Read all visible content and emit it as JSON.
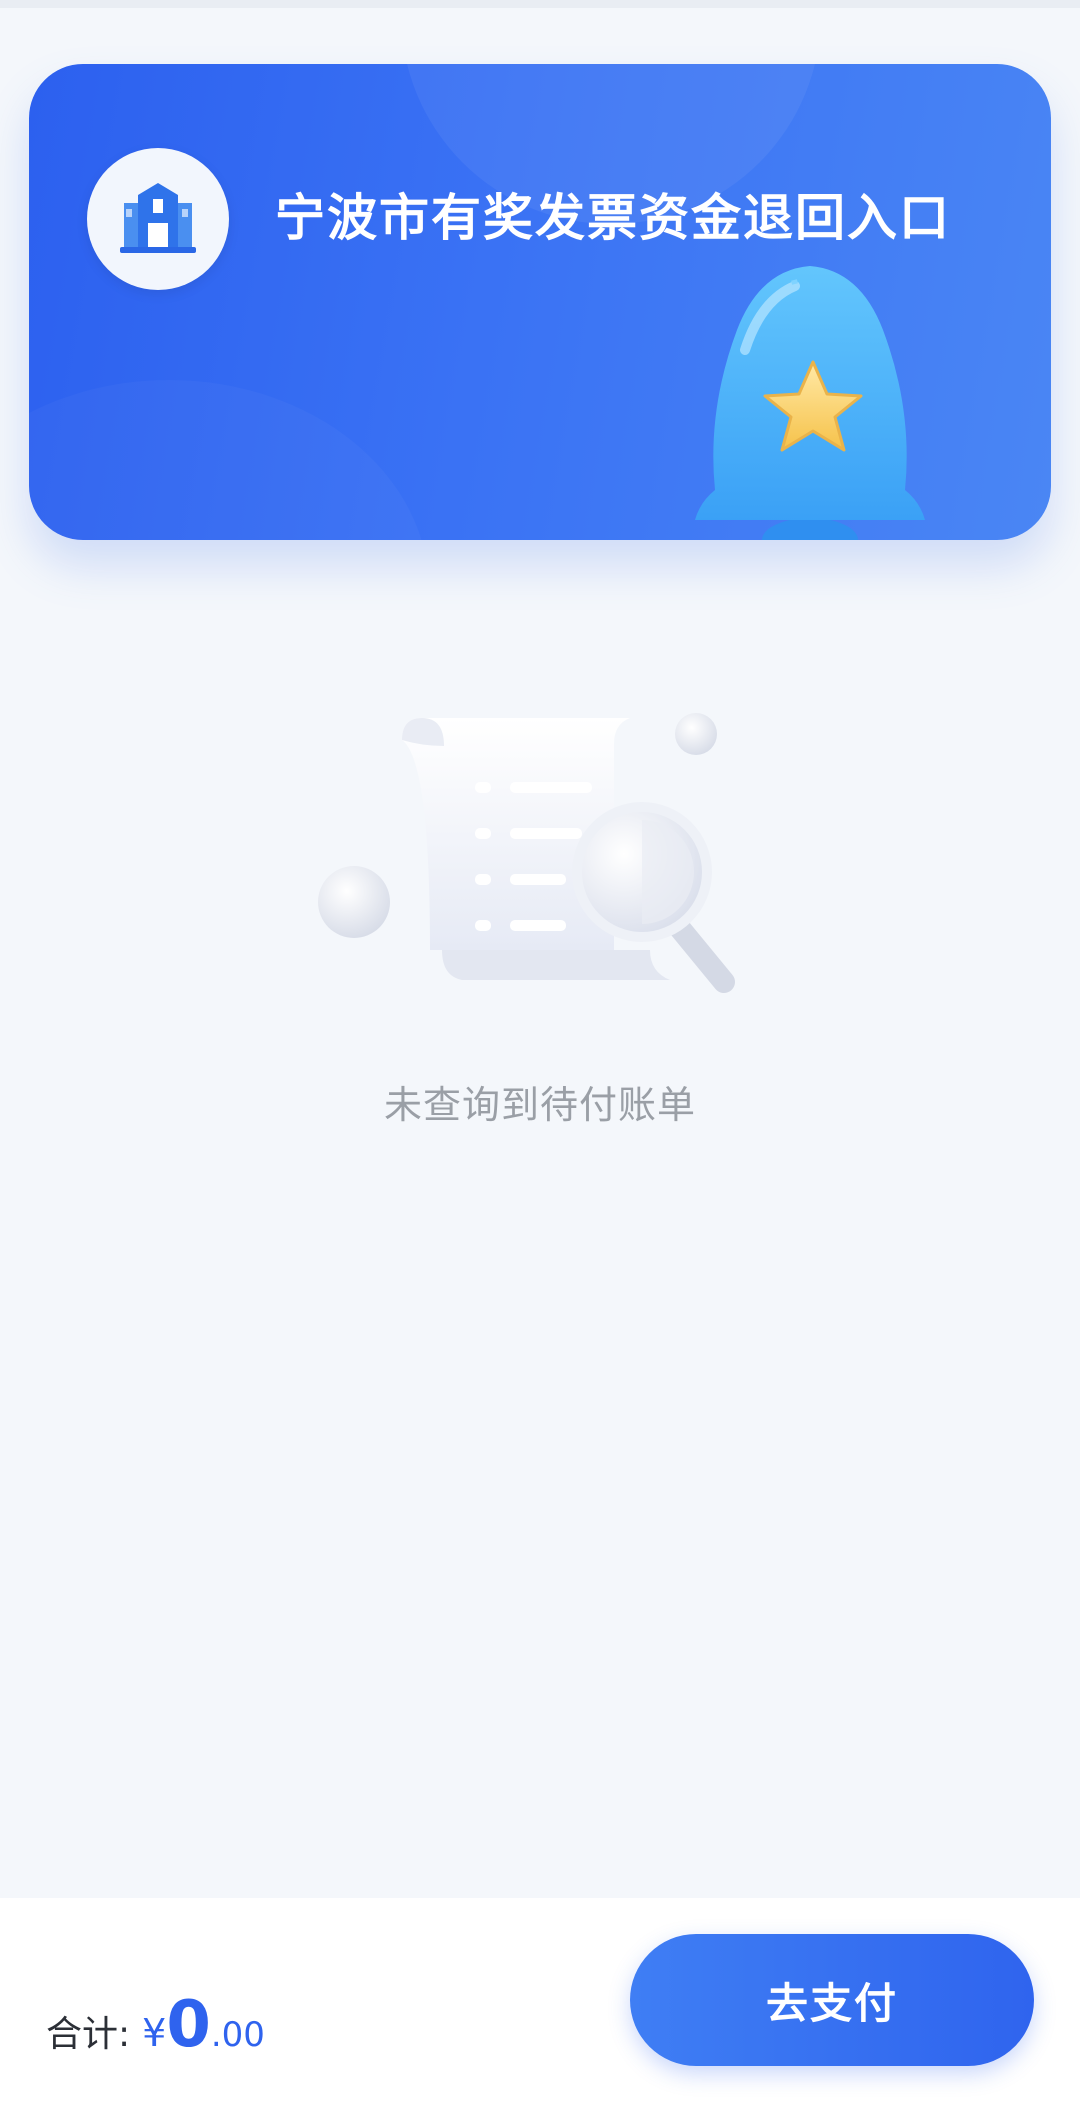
{
  "banner": {
    "title": "宁波市有奖发票资金退回入口",
    "logo_icon": "government-building-icon",
    "decoration_icon": "bell-star-icon"
  },
  "empty_state": {
    "illustration_icon": "receipt-search-icon",
    "message": "未查询到待付账单"
  },
  "footer": {
    "total_label": "合计:",
    "currency_symbol": "¥",
    "amount_integer": "0",
    "amount_decimal": ".00",
    "pay_button_label": "去支付"
  },
  "colors": {
    "accent": "#2f63ee",
    "banner_start": "#2c60ef",
    "banner_end": "#4a86f4",
    "background": "#f4f7fb",
    "muted_text": "#9a9fa6"
  }
}
